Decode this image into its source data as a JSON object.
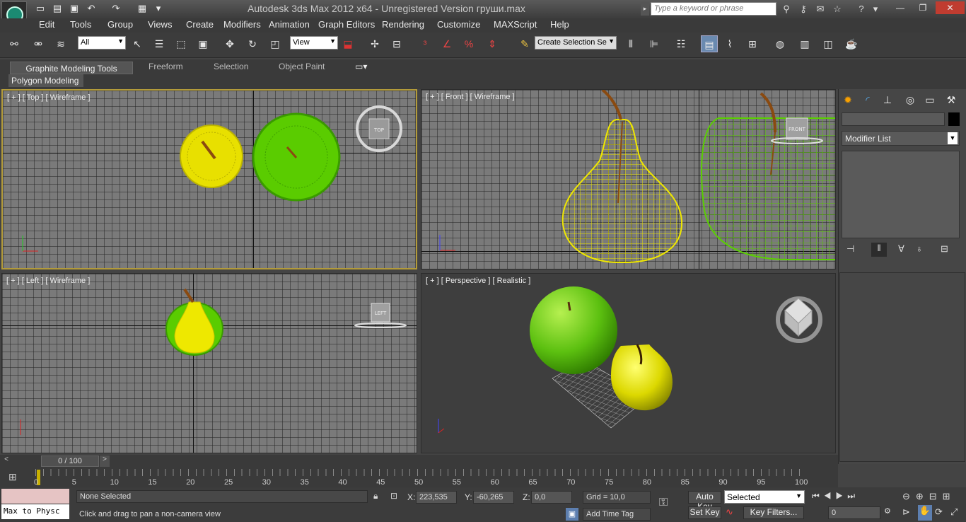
{
  "app": {
    "title": "Autodesk 3ds Max  2012 x64  -  Unregistered Version    груши.max",
    "search_placeholder": "Type a keyword or phrase"
  },
  "menu": [
    "Edit",
    "Tools",
    "Group",
    "Views",
    "Create",
    "Modifiers",
    "Animation",
    "Graph Editors",
    "Rendering",
    "Customize",
    "MAXScript",
    "Help"
  ],
  "toolbar": {
    "selection_filter": "All",
    "reference_coord": "View",
    "named_selection": "Create Selection Se"
  },
  "ribbon": {
    "tabs": [
      "Graphite Modeling Tools",
      "Freeform",
      "Selection",
      "Object Paint"
    ],
    "subtab": "Polygon Modeling"
  },
  "viewports": {
    "top": "[ + ] [ Top ] [ Wireframe ]",
    "front": "[ + ] [ Front ] [ Wireframe ]",
    "left": "[ + ] [ Left ] [ Wireframe ]",
    "perspective": "[ + ] [ Perspective ] [ Realistic ]",
    "viewcube_top": "TOP",
    "viewcube_front": "FRONT",
    "viewcube_left": "LEFT"
  },
  "command_panel": {
    "modifier_list": "Modifier List"
  },
  "timeline": {
    "frame_display": "0 / 100",
    "ticks": [
      "0",
      "5",
      "10",
      "15",
      "20",
      "25",
      "30",
      "35",
      "40",
      "45",
      "50",
      "55",
      "60",
      "65",
      "70",
      "75",
      "80",
      "85",
      "90",
      "95",
      "100"
    ]
  },
  "status": {
    "maxscript": "Max to Physc",
    "selection": "None Selected",
    "prompt": "Click and drag to pan a non-camera view",
    "x_label": "X:",
    "x_value": "223,535",
    "y_label": "Y:",
    "y_value": "-60,265",
    "z_label": "Z:",
    "z_value": "0,0",
    "grid": "Grid = 10,0",
    "add_time_tag": "Add Time Tag",
    "auto_key": "Auto Key",
    "set_key": "Set Key",
    "key_mode": "Selected",
    "key_filters": "Key Filters...",
    "current_frame": "0"
  },
  "colors": {
    "selected_viewport_border": "#b39b3a",
    "pear_yellow": "#e8e000",
    "apple_green": "#66cc00",
    "close_button": "#c03c30"
  }
}
